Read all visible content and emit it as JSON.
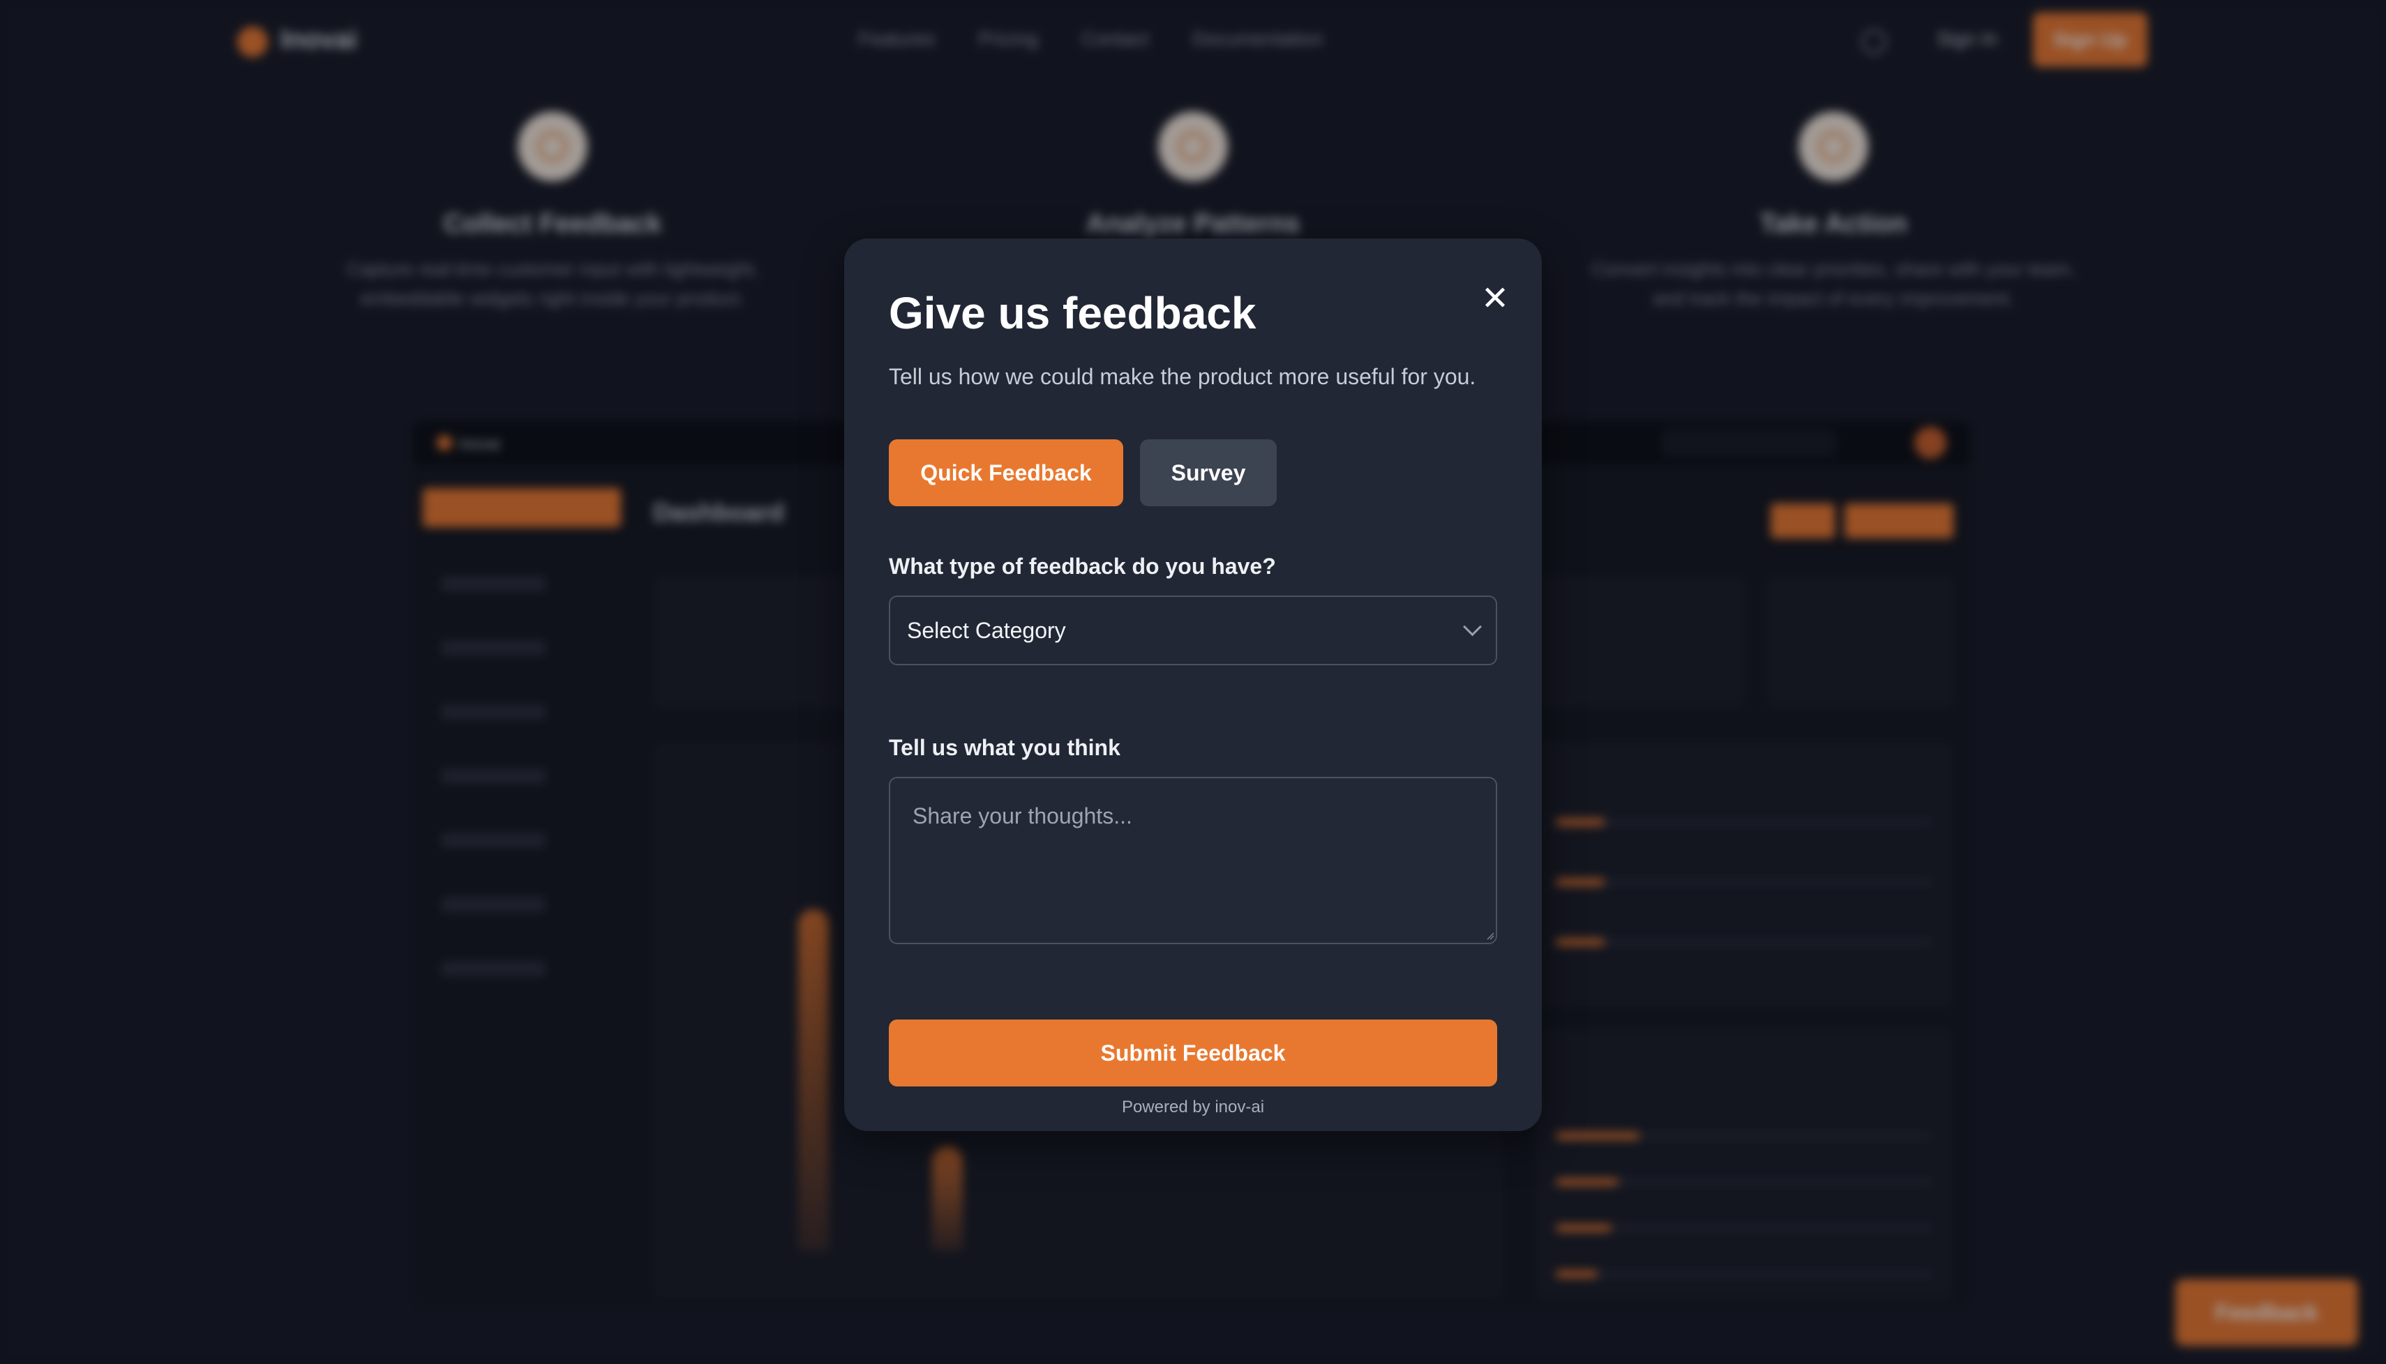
{
  "background": {
    "brand": "Inovai",
    "nav_links": [
      "Features",
      "Pricing",
      "Contact",
      "Documentation"
    ],
    "sign_in": "Sign In",
    "sign_up": "Sign Up",
    "features": [
      {
        "title": "Collect Feedback",
        "desc": "Capture real-time customer input with lightweight, embeddable widgets right inside your product."
      },
      {
        "title": "Analyze Patterns",
        "desc": ""
      },
      {
        "title": "Take Action",
        "desc": "Convert insights into clear priorities, share with your team, and track the impact of every improvement."
      }
    ],
    "dashboard_title": "Dashboard",
    "floating_button": "Feedback"
  },
  "modal": {
    "title": "Give us feedback",
    "subtitle": "Tell us how we could make the product more useful for you.",
    "close_symbol": "✕",
    "tabs": [
      {
        "label": "Quick Feedback",
        "active": true
      },
      {
        "label": "Survey",
        "active": false
      }
    ],
    "category_label": "What type of feedback do you have?",
    "category_value": "Select Category",
    "thoughts_label": "Tell us what you think",
    "thoughts_placeholder": "Share your thoughts...",
    "submit_label": "Submit Feedback",
    "powered_by": "Powered by inov-ai"
  },
  "colors": {
    "accent": "#e8782f",
    "modal_bg": "#212734",
    "page_bg": "#151924"
  }
}
